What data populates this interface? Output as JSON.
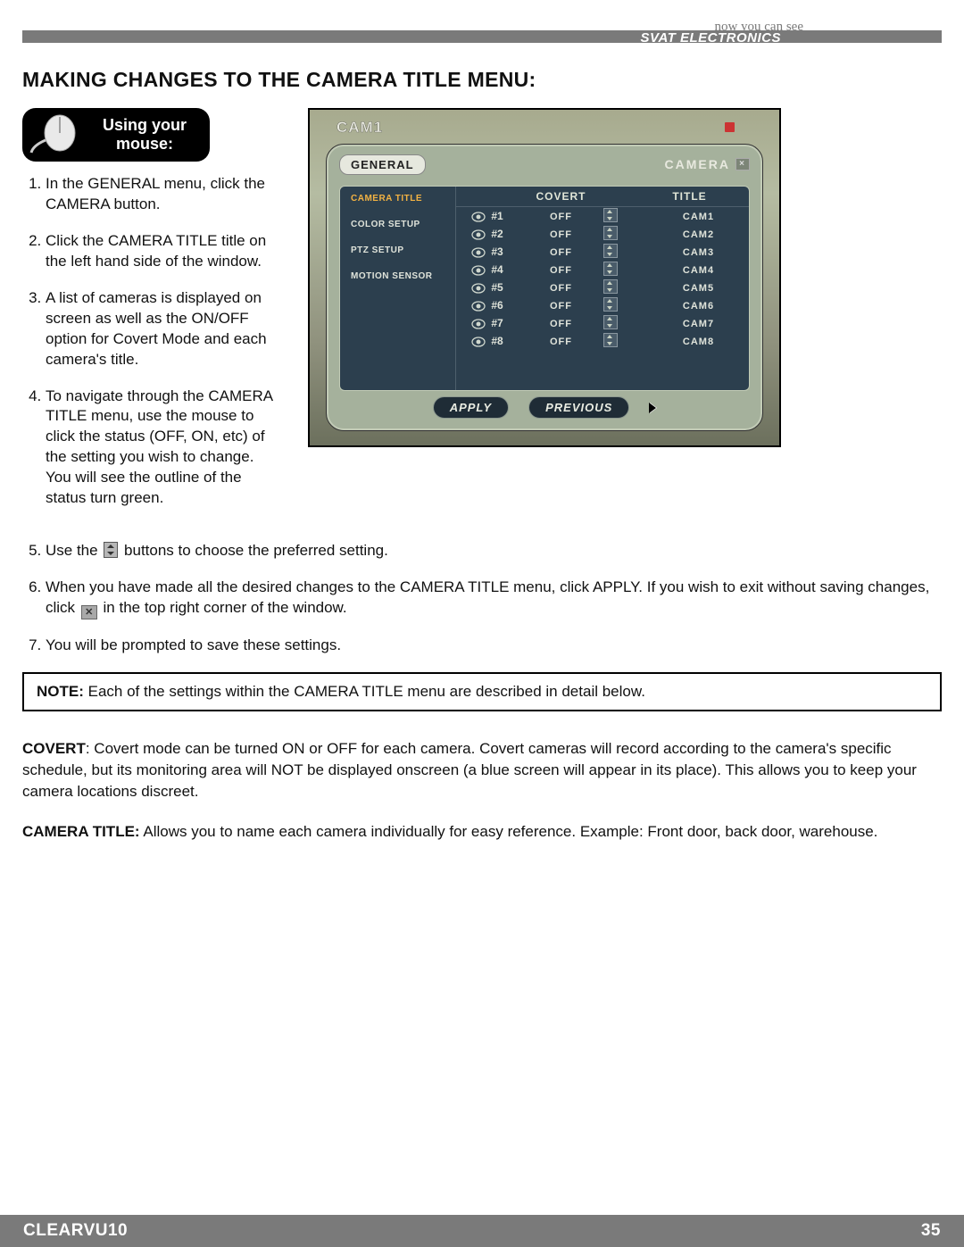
{
  "brand": "SVAT ELECTRONICS",
  "slogan": "now you can see",
  "heading": "MAKING CHANGES TO THE CAMERA TITLE MENU:",
  "mouse_badge": {
    "line1": "Using your",
    "line2": "mouse:"
  },
  "steps": {
    "1": "In the GENERAL menu, click the CAMERA button.",
    "2": "Click the CAMERA TITLE title on the left hand side of the window.",
    "3": "A list of cameras is displayed on screen as well as the ON/OFF option for Covert Mode and each camera's title.",
    "4": "To navigate through the CAMERA TITLE menu, use the mouse to click the status (OFF, ON, etc) of the setting you wish to change.  You will see the outline of the status turn green.",
    "5a": "Use the ",
    "5b": " buttons to choose the preferred setting.",
    "6a": "When you have made all the desired changes to the CAMERA TITLE menu, click APPLY.  If you wish to exit without saving changes, click ",
    "6b": " in the top right corner of the window.",
    "7": "You will be prompted to save these settings."
  },
  "note": {
    "label": "NOTE:",
    "text": " Each of the settings within the CAMERA TITLE menu are described in detail below."
  },
  "defs": {
    "covert_label": "COVERT",
    "covert_text": ": Covert mode can be turned ON or OFF for each camera.  Covert cameras will record according to the camera's specific schedule, but its monitoring area will NOT be displayed onscreen (a blue screen will appear in its place).  This allows you to keep your camera locations discreet.",
    "camtitle_label": "CAMERA TITLE:",
    "camtitle_text": "  Allows you to name each camera individually for easy reference. Example: Front door, back door, warehouse."
  },
  "shot": {
    "cam_label": "CAM1",
    "panel_title": "GENERAL",
    "tab_right": "CAMERA",
    "side_menu": [
      "CAMERA TITLE",
      "COLOR SETUP",
      "PTZ SETUP",
      "MOTION SENSOR"
    ],
    "headers": {
      "covert": "COVERT",
      "title": "TITLE"
    },
    "rows": [
      {
        "idx": "#1",
        "covert": "OFF",
        "title": "CAM1"
      },
      {
        "idx": "#2",
        "covert": "OFF",
        "title": "CAM2"
      },
      {
        "idx": "#3",
        "covert": "OFF",
        "title": "CAM3"
      },
      {
        "idx": "#4",
        "covert": "OFF",
        "title": "CAM4"
      },
      {
        "idx": "#5",
        "covert": "OFF",
        "title": "CAM5"
      },
      {
        "idx": "#6",
        "covert": "OFF",
        "title": "CAM6"
      },
      {
        "idx": "#7",
        "covert": "OFF",
        "title": "CAM7"
      },
      {
        "idx": "#8",
        "covert": "OFF",
        "title": "CAM8"
      }
    ],
    "buttons": {
      "apply": "APPLY",
      "previous": "PREVIOUS"
    }
  },
  "footer": {
    "product": "CLEARVU10",
    "page": "35"
  }
}
